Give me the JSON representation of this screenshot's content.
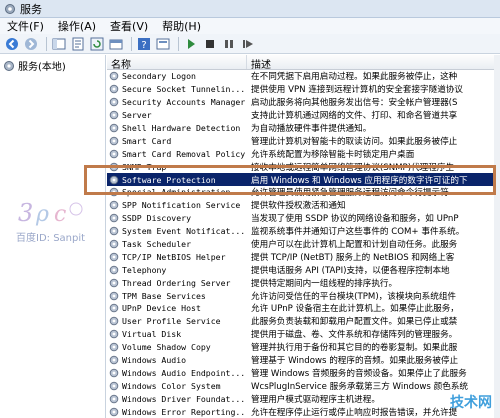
{
  "window": {
    "title": "服务"
  },
  "menu": [
    "文件(F)",
    "操作(A)",
    "查看(V)",
    "帮助(H)"
  ],
  "toolbar_icons": [
    "back-icon",
    "forward-icon",
    "console-tree-icon",
    "properties-icon",
    "refresh-icon",
    "export-icon",
    "help-icon",
    "view-icon",
    "play-icon",
    "stop-icon",
    "pause-icon",
    "restart-icon"
  ],
  "tree": {
    "item_label": "服务(本地)"
  },
  "columns": {
    "name": "名称",
    "desc": "描述"
  },
  "rows": [
    {
      "name": "Secondary Logon",
      "desc": "在不同凭据下启用启动过程。如果此服务被停止，这种"
    },
    {
      "name": "Secure Socket Tunnelin...",
      "desc": "提供使用 VPN 连接到远程计算机的安全套接字隧道协议"
    },
    {
      "name": "Security Accounts Manager",
      "desc": "启动此服务将向其他服务发出信号：安全帐户管理器(S"
    },
    {
      "name": "Server",
      "desc": "支持此计算机通过网络的文件、打印、和命名管道共享"
    },
    {
      "name": "Shell Hardware Detection",
      "desc": "为自动播放硬件事件提供通知。"
    },
    {
      "name": "Smart Card",
      "desc": "管理此计算机对智能卡的取读访问。如果此服务被停止"
    },
    {
      "name": "Smart Card Removal Policy",
      "desc": "允许系统配置为移除智能卡时锁定用户桌面"
    },
    {
      "name": "SNMP Trap",
      "desc": "接收本地或远程简单网络管理协议(SNMP)代理程序生"
    },
    {
      "name": "Software Protection",
      "desc": "启用 Windows 和 Windows 应用程序的数字许可证的下"
    },
    {
      "name": "Special Administration ...",
      "desc": "允许管理员使用紧急管理服务远程访问命令行提示符"
    },
    {
      "name": "SPP Notification Service",
      "desc": "提供软件授权激活和通知"
    },
    {
      "name": "SSDP Discovery",
      "desc": "当发现了使用 SSDP 协议的网络设备和服务，如 UPnP"
    },
    {
      "name": "System Event Notificat...",
      "desc": "监视系统事件并通知订户这些事件的 COM+ 事件系统。"
    },
    {
      "name": "Task Scheduler",
      "desc": "使用户可以在此计算机上配置和计划自动任务。此服务"
    },
    {
      "name": "TCP/IP NetBIOS Helper",
      "desc": "提供 TCP/IP (NetBT) 服务上的 NetBIOS 和网络上客"
    },
    {
      "name": "Telephony",
      "desc": "提供电话服务 API (TAPI)支持，以便各程序控制本地"
    },
    {
      "name": "Thread Ordering Server",
      "desc": "提供特定期间内一组线程的排序执行。"
    },
    {
      "name": "TPM Base Services",
      "desc": "允许访问受信任的平台模块(TPM)，该模块向系统组件"
    },
    {
      "name": "UPnP Device Host",
      "desc": "允许 UPnP 设备宿主在此计算机上。如果停止此服务，"
    },
    {
      "name": "User Profile Service",
      "desc": "此服务负责装载和卸载用户配置文件。如果已停止或禁"
    },
    {
      "name": "Virtual Disk",
      "desc": "提供用于磁盘、卷、文件系统和存储阵列的管理服务。"
    },
    {
      "name": "Volume Shadow Copy",
      "desc": "管理并执行用于备份和其它目的的卷影复制。如果此服"
    },
    {
      "name": "Windows Audio",
      "desc": "管理基于 Windows 的程序的音频。如果此服务被停止"
    },
    {
      "name": "Windows Audio Endpoint...",
      "desc": "管理 Windows 音频服务的音频设备。如果停止了此服务"
    },
    {
      "name": "Windows Color System",
      "desc": "WcsPlugInService 服务承载第三方 Windows 颜色系统"
    },
    {
      "name": "Windows Driver Foundat...",
      "desc": "管理用户模式驱动程序主机进程。"
    },
    {
      "name": "Windows Error Reporting...",
      "desc": "允许在程序停止运行或停止响应时报告错误，并允许提"
    }
  ],
  "selected_row": "Software Protection",
  "watermark": {
    "left_text": "百度ID: Sanpit",
    "right_text": "技术网"
  },
  "colors": {
    "selected_bg": "#0a246a",
    "highlight_border": "#c07a4a"
  }
}
